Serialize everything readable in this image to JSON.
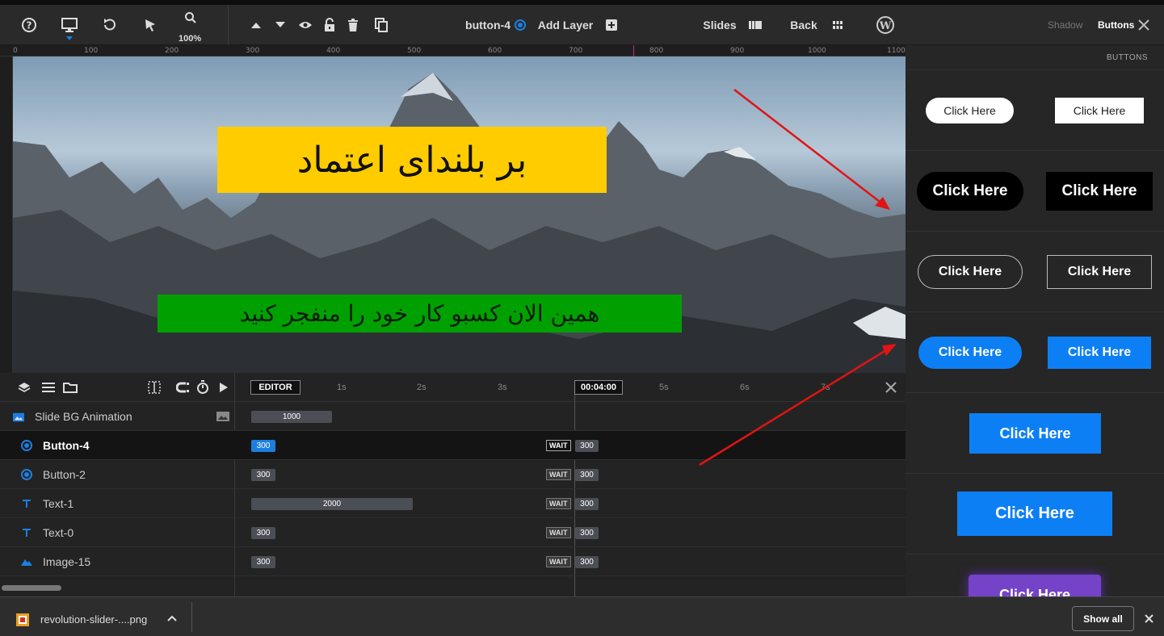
{
  "toolbar": {
    "zoom": "100%",
    "layer_name": "button-4",
    "add_layer": "Add Layer",
    "slides": "Slides",
    "back": "Back"
  },
  "ruler": {
    "marks": [
      "0",
      "100",
      "200",
      "300",
      "400",
      "500",
      "600",
      "700",
      "800",
      "900",
      "1000",
      "1100"
    ]
  },
  "canvas": {
    "headline": "بر بلندای اعتماد",
    "subline": "همین الان کسبو کار خود را منفجر کنید"
  },
  "timeline": {
    "editor": "EDITOR",
    "current_time": "00:04:00",
    "seconds": [
      "1s",
      "2s",
      "3s",
      "5s",
      "6s",
      "7s"
    ],
    "rows": [
      {
        "name": "Slide BG Animation",
        "icon": "image-icon",
        "bar": "1000"
      },
      {
        "name": "Button-4",
        "icon": "button-target-icon",
        "bar": "300",
        "wait": "WAIT",
        "out": "300"
      },
      {
        "name": "Button-2",
        "icon": "button-target-icon",
        "bar": "300",
        "wait": "WAIT",
        "out": "300"
      },
      {
        "name": "Text-1",
        "icon": "text-icon",
        "bar": "2000",
        "wait": "WAIT",
        "out": "300"
      },
      {
        "name": "Text-0",
        "icon": "text-icon",
        "bar": "300",
        "wait": "WAIT",
        "out": "300"
      },
      {
        "name": "Image-15",
        "icon": "mountain-image-icon",
        "bar": "300",
        "wait": "WAIT",
        "out": "300"
      }
    ]
  },
  "right_panel": {
    "tab_shadow": "Shadow",
    "tab_buttons": "Buttons",
    "section_title": "BUTTONS",
    "button_label": "Click Here"
  },
  "download_bar": {
    "file_name": "revolution-slider-....png",
    "show_all": "Show all"
  },
  "colors": {
    "accent_blue": "#0d7ff5",
    "yellow_layer": "#ffcc00",
    "green_layer": "#00a000",
    "arrow_red": "#e01414",
    "purple_button": "#7443c7"
  }
}
